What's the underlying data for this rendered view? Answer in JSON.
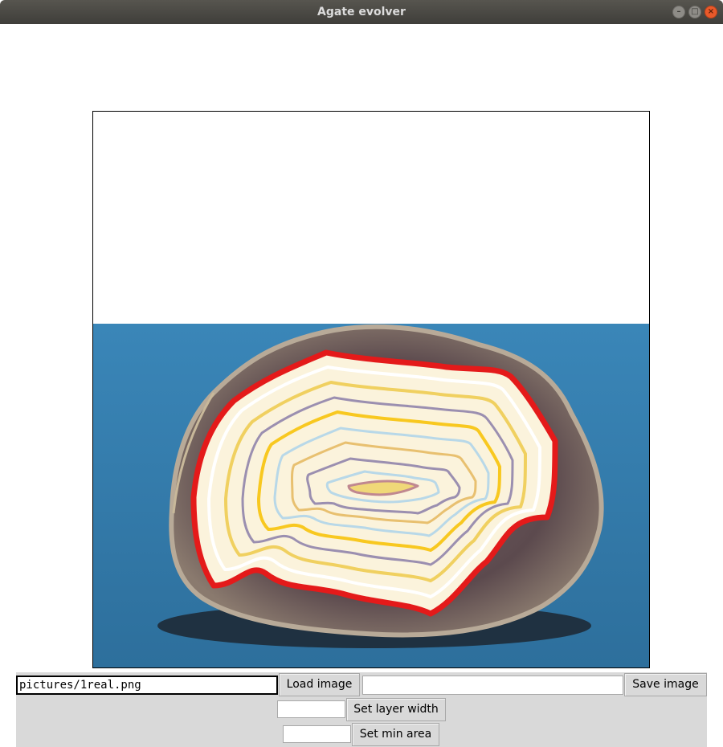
{
  "window": {
    "title": "Agate evolver"
  },
  "controls": {
    "path_input_value": "pictures/1real.png",
    "load_button": "Load image",
    "save_input_value": "",
    "save_button": "Save image",
    "layer_width_input_value": "",
    "layer_width_button": "Set layer width",
    "min_area_input_value": "",
    "min_area_button": "Set min area"
  },
  "image": {
    "description_icon": "agate-slab-image",
    "background_color": "#3a82b6",
    "band_colors": [
      "#e41a1a",
      "#ffffff",
      "#f0d060",
      "#9b8fb0",
      "#f8c820",
      "#b8d8e8",
      "#e8c070"
    ]
  }
}
